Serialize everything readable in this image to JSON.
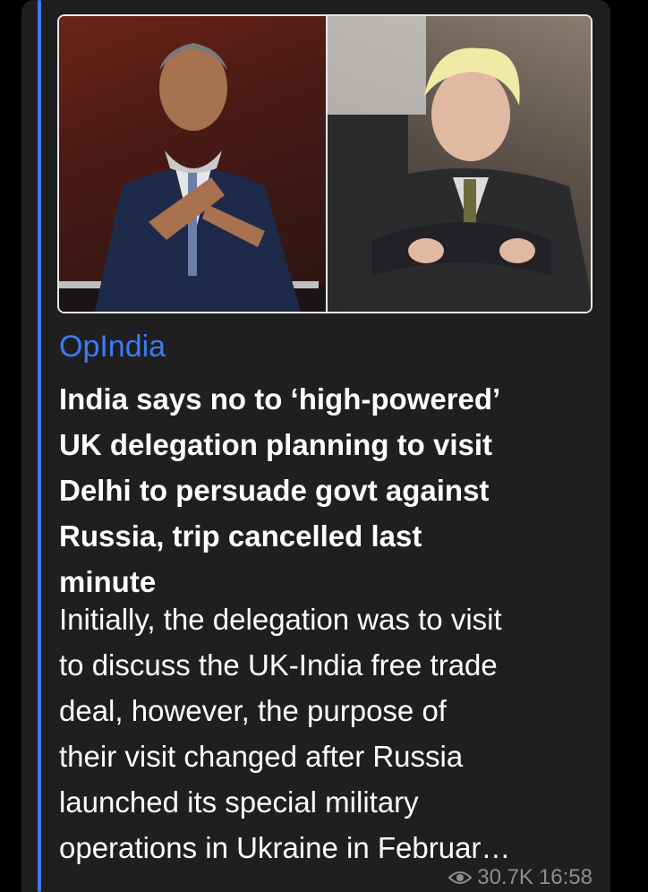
{
  "message": {
    "source": "OpIndia",
    "headline_lines": [
      "India says no to ‘high-powered’",
      "UK delegation planning to visit",
      "Delhi to persuade govt against",
      "Russia, trip cancelled last",
      "minute"
    ],
    "summary_lines": [
      "Initially, the delegation was to visit",
      "to discuss the UK-India free trade",
      "deal, however, the purpose of",
      "their visit changed after Russia",
      "launched its special military",
      "operations in Ukraine in Februar…"
    ],
    "views": "30.7K",
    "time": "16:58"
  },
  "colors": {
    "accent": "#3d7bf5",
    "bubble": "#1f1f1f",
    "meta": "#8e8e93"
  },
  "icons": {
    "views": "eye-icon"
  }
}
